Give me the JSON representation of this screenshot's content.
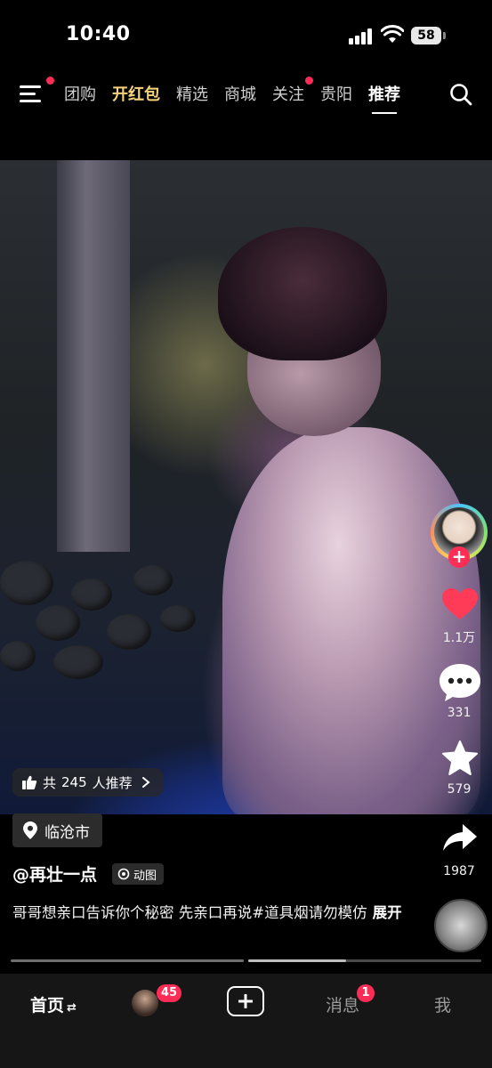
{
  "status_bar": {
    "time": "10:40",
    "battery": "58"
  },
  "top_nav": {
    "tabs": [
      {
        "label": "团购",
        "dot": false,
        "style": "normal"
      },
      {
        "label": "开红包",
        "dot": false,
        "style": "gold"
      },
      {
        "label": "精选",
        "dot": false,
        "style": "normal"
      },
      {
        "label": "商城",
        "dot": false,
        "style": "normal"
      },
      {
        "label": "关注",
        "dot": true,
        "style": "normal"
      },
      {
        "label": "贵阳",
        "dot": false,
        "style": "normal"
      },
      {
        "label": "推荐",
        "dot": false,
        "style": "active"
      }
    ],
    "accent_gold": "#f6d37a",
    "dot_color": "#ff2d55"
  },
  "video": {
    "recommend_pill": {
      "prefix": "共",
      "count": "245",
      "suffix": "人推荐",
      "icon": "thumbs-up-icon"
    }
  },
  "right_rail": {
    "like_count": "1.1万",
    "like_color": "#ff3b57",
    "comment_count": "331",
    "favorite_count": "579",
    "share_count": "1987"
  },
  "post": {
    "location": "临沧市",
    "author": "@再壮一点",
    "gif_badge": "动图",
    "caption": "哥哥想亲口告诉你个秘密 先亲口再说#道具烟请勿模仿",
    "expand_label": "展开"
  },
  "progress": {
    "played_fraction": 0.42
  },
  "tab_bar": {
    "home_label": "首页",
    "home_suffix": "⇄",
    "friends_badge": "45",
    "messages_label": "消息",
    "messages_badge": "1",
    "me_label": "我"
  }
}
